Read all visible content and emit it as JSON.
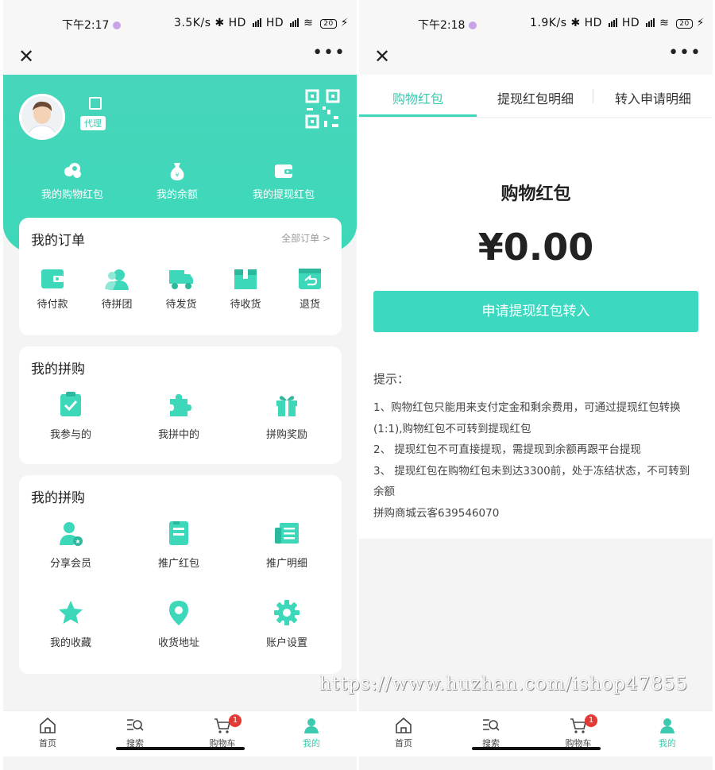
{
  "left": {
    "status": {
      "time": "下午2:17",
      "speed": "3.5K/s",
      "battery": "20"
    },
    "header": {
      "tag": "代理",
      "items": [
        {
          "label": "我的购物红包",
          "icon": "cloud-coins-icon"
        },
        {
          "label": "我的余额",
          "icon": "money-bag-icon"
        },
        {
          "label": "我的提现红包",
          "icon": "wallet-icon"
        }
      ]
    },
    "orders": {
      "title": "我的订单",
      "all_label": "全部订单",
      "items": [
        {
          "label": "待付款",
          "icon": "wallet-icon"
        },
        {
          "label": "待拼团",
          "icon": "group-icon"
        },
        {
          "label": "待发货",
          "icon": "truck-icon"
        },
        {
          "label": "待收货",
          "icon": "box-icon"
        },
        {
          "label": "退货",
          "icon": "return-icon"
        }
      ]
    },
    "group_buy": {
      "title": "我的拼购",
      "items": [
        {
          "label": "我参与的",
          "icon": "clipboard-check-icon"
        },
        {
          "label": "我拼中的",
          "icon": "puzzle-icon"
        },
        {
          "label": "拼购奖励",
          "icon": "gift-icon"
        }
      ]
    },
    "group_buy2": {
      "title": "我的拼购",
      "items": [
        {
          "label": "分享会员",
          "icon": "user-star-icon"
        },
        {
          "label": "推广红包",
          "icon": "red-packet-icon"
        },
        {
          "label": "推广明细",
          "icon": "list-doc-icon"
        },
        {
          "label": "我的收藏",
          "icon": "star-icon"
        },
        {
          "label": "收货地址",
          "icon": "location-pin-icon"
        },
        {
          "label": "账户设置",
          "icon": "gear-icon"
        }
      ]
    }
  },
  "right": {
    "status": {
      "time": "下午2:18",
      "speed": "1.9K/s",
      "battery": "20"
    },
    "tabs": [
      "购物红包",
      "提现红包明细",
      "转入申请明细"
    ],
    "title": "购物红包",
    "amount": "¥0.00",
    "button": "申请提现红包转入",
    "tips_title": "提示：",
    "tips": [
      "1、购物红包只能用来支付定金和剩余费用，可通过提现红包转换(1:1),购物红包不可转到提现红包",
      "2、 提现红包不可直接提现，需提现到余额再跟平台提现",
      "3、 提现红包在购物红包未到达3300前，处于冻结状态，不可转到余额",
      "拼购商城云客639546070"
    ]
  },
  "tabbar": {
    "items": [
      {
        "label": "首页",
        "icon": "home-icon"
      },
      {
        "label": "搜索",
        "icon": "search-icon"
      },
      {
        "label": "购物车",
        "icon": "cart-icon"
      },
      {
        "label": "我的",
        "icon": "user-icon"
      }
    ],
    "cart_badge": "1"
  },
  "watermark": "https://www.huzhan.com/ishop47855",
  "colors": {
    "accent": "#3cd8b9",
    "badge": "#e53935"
  }
}
